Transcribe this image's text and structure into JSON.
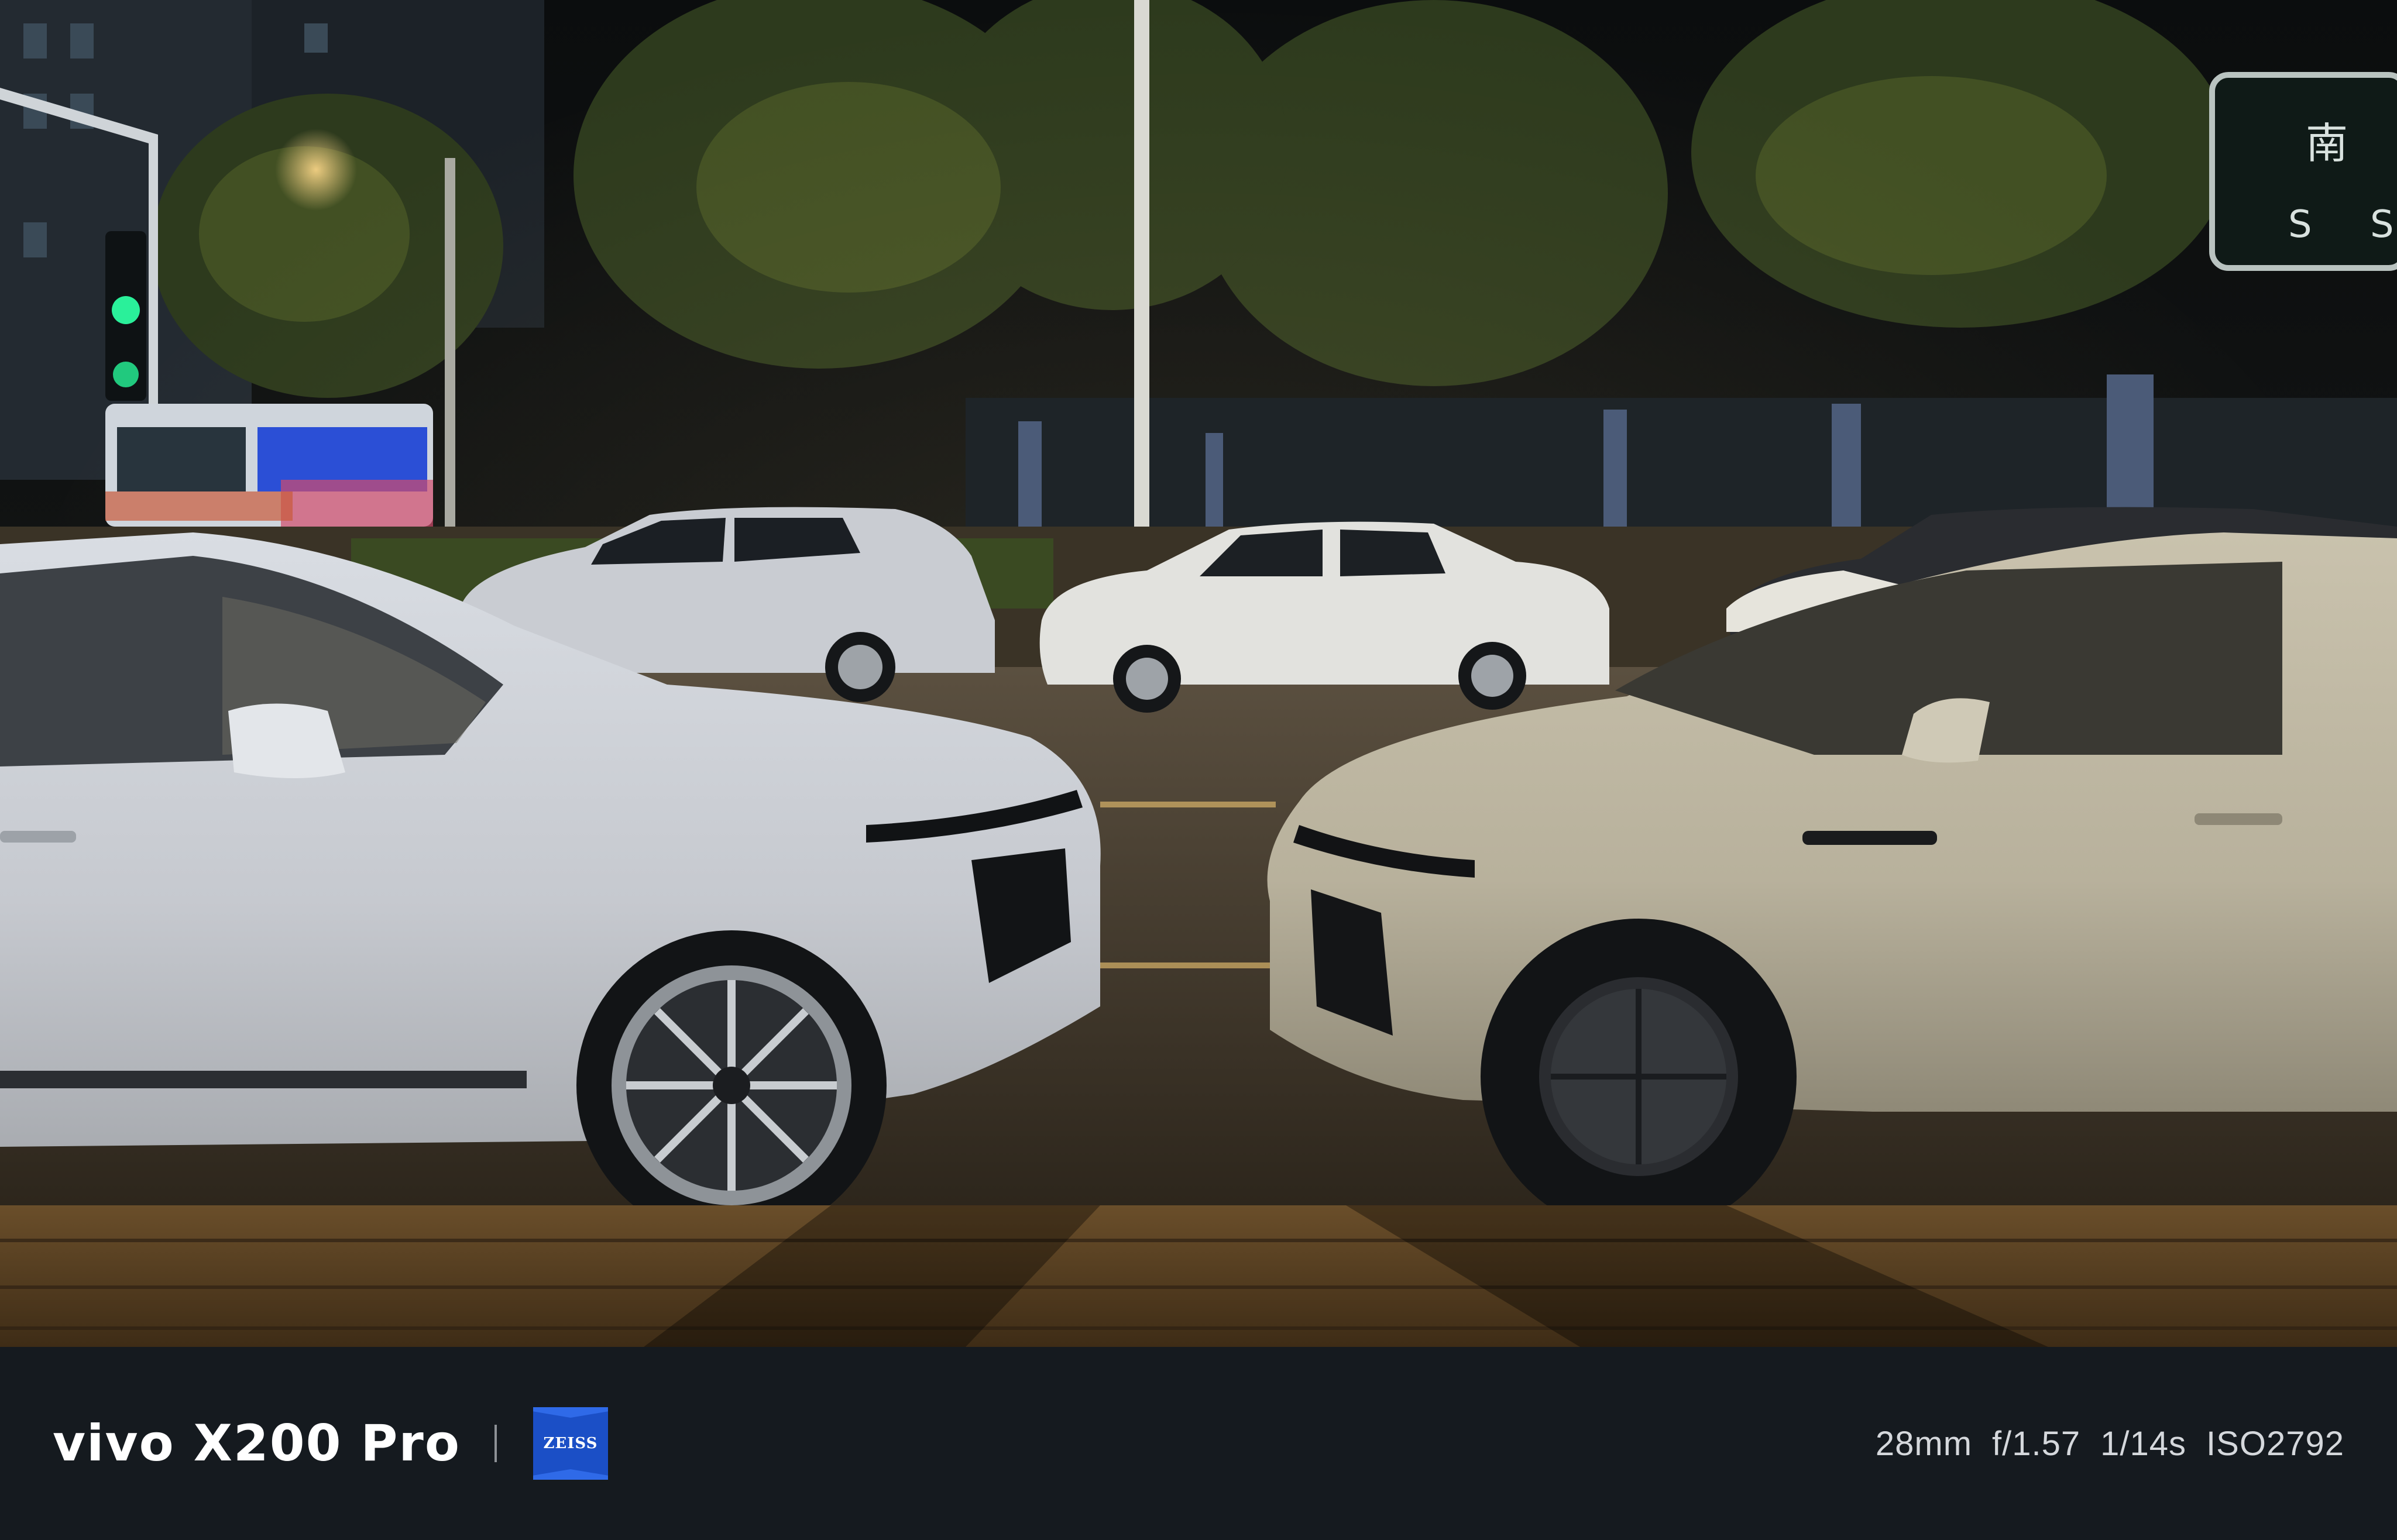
{
  "photo": {
    "description_hidden": "",
    "sign_char": "南",
    "sign_letter": "S",
    "sign_letter2": "S"
  },
  "watermark": {
    "brand": "vivo X200 Pro",
    "lens_logo": "ZEISS",
    "focal_length": "28mm",
    "aperture": "f/1.57",
    "shutter": "1/14s",
    "iso": "ISO2792"
  },
  "colors": {
    "bar_bg": "#151a1f",
    "zeiss_blue": "#1b4fc6"
  }
}
